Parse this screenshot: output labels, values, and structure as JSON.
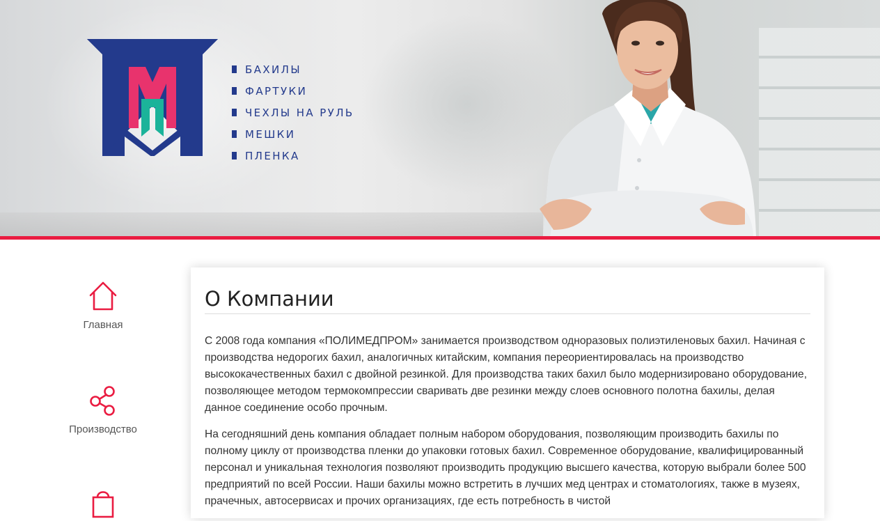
{
  "hero": {
    "menu": [
      "БАХИЛЫ",
      "ФАРТУКИ",
      "ЧЕХЛЫ НА РУЛЬ",
      "МЕШКИ",
      "ПЛЕНКА"
    ],
    "logo_letters": "МП",
    "colors": {
      "brand_blue": "#233a8c",
      "accent_red": "#ea1c41",
      "logo_pink": "#e8336d",
      "logo_teal": "#1bb39a"
    }
  },
  "side_nav": {
    "items": [
      {
        "label": "Главная",
        "icon": "home-icon"
      },
      {
        "label": "Производство",
        "icon": "share-icon"
      },
      {
        "label": "",
        "icon": "shopping-bag-icon"
      }
    ]
  },
  "content": {
    "title": "О Компании",
    "paragraphs": [
      "С 2008 года компания «ПОЛИМЕДПРОМ» занимается производством одноразовых полиэтиленовых бахил. Начиная с производства недорогих бахил, аналогичных китайским, компания переориентировалась на производство высококачественных бахил с двойной резинкой. Для производства таких бахил было модернизировано оборудование, позволяющее методом термокомпрессии сваривать две резинки между слоев основного полотна бахилы, делая данное соединение особо прочным.",
      "На сегодняшний день компания обладает полным набором оборудования, позволяющим производить бахилы по полному циклу от производства пленки до упаковки готовых бахил. Современное оборудование, квалифицированный персонал и уникальная технология позволяют производить продукцию высшего качества, которую выбрали более 500 предприятий по всей России. Наши бахилы можно встретить в лучших мед центрах и стоматологиях, также в музеях, прачечных, автосервисах и прочих организациях, где есть потребность в чистой"
    ]
  }
}
